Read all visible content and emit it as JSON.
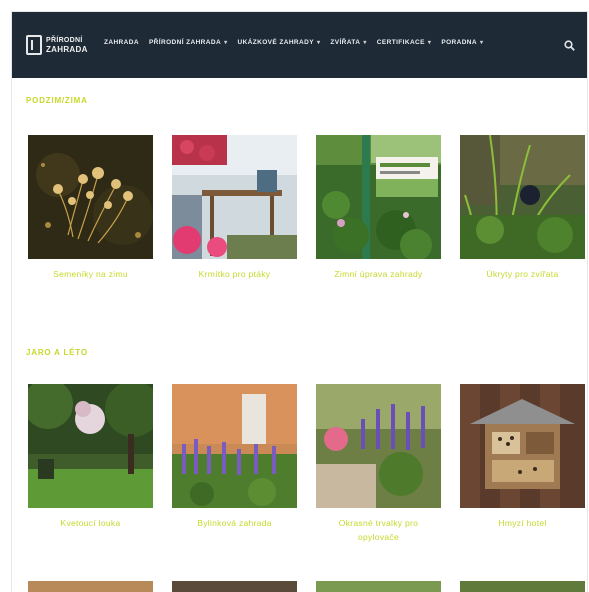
{
  "header": {
    "logo": {
      "line1": "PŘÍRODNÍ",
      "line2": "ZAHRADA",
      "line3": ""
    },
    "menu": [
      {
        "label": "ZAHRADA",
        "has_caret": false
      },
      {
        "label": "PŘÍRODNÍ ZAHRADA",
        "has_caret": true
      },
      {
        "label": "UKÁZKOVÉ ZAHRADY",
        "has_caret": true
      },
      {
        "label": "ZVÍŘATA",
        "has_caret": true
      },
      {
        "label": "CERTIFIKACE",
        "has_caret": true
      },
      {
        "label": "PORADNA",
        "has_caret": true
      }
    ]
  },
  "sections": [
    {
      "title": "PODZIM/ZIMA",
      "items": [
        {
          "caption": "Semeníky na zimu",
          "image": "seedheads"
        },
        {
          "caption": "Krmítko pro ptáky",
          "image": "feeder"
        },
        {
          "caption": "Zimní úprava zahrady",
          "image": "book"
        },
        {
          "caption": "Úkryty pro zvířata",
          "image": "grass"
        }
      ]
    },
    {
      "title": "JARO A LÉTO",
      "items": [
        {
          "caption": "Kvetoucí louka",
          "image": "park"
        },
        {
          "caption": "Bylinková zahrada",
          "image": "lavender"
        },
        {
          "caption": "Okrasné trvalky pro opylovače",
          "image": "salvia"
        },
        {
          "caption": "Hmyzí hotel",
          "image": "insecthotel"
        }
      ]
    }
  ],
  "partial_row_images": [
    "wood",
    "shed",
    "garden",
    "meadow"
  ]
}
